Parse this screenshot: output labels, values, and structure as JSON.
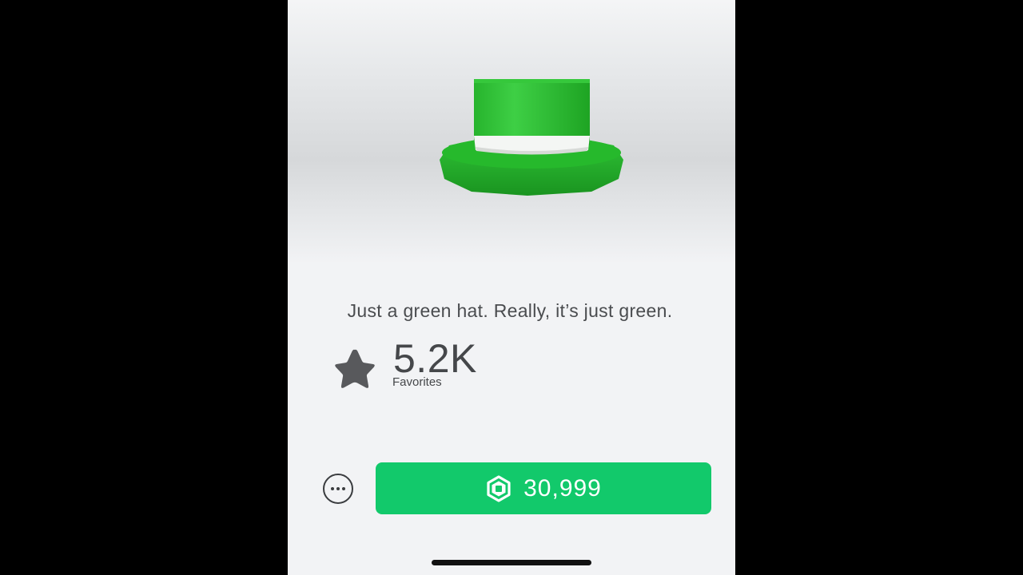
{
  "item": {
    "description": "Just a green hat. Really, it’s just green.",
    "preview_icon": "green-top-hat"
  },
  "favorites": {
    "count": "5.2K",
    "label": "Favorites",
    "icon": "star-icon"
  },
  "purchase": {
    "price": "30,999",
    "currency_icon": "robux-icon",
    "more_icon": "more-options-icon",
    "button_color": "#12c96b"
  }
}
